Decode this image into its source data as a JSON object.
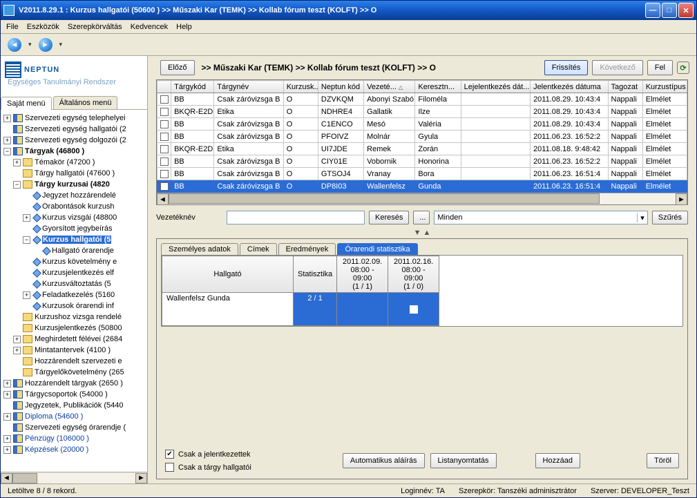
{
  "title": "V2011.8.29.1 : Kurzus hallgatói (50600  )   >> Műszaki Kar (TEMK) >> Kollab fórum teszt (KOLFT) >> O",
  "menus": [
    "File",
    "Eszközök",
    "Szerepkörváltás",
    "Kedvencek",
    "Help"
  ],
  "logo": {
    "name": "NEPTUN",
    "sub": "Egységes Tanulmányi Rendszer"
  },
  "sidebar_tabs": {
    "active": "Saját menü",
    "other": "Általános menü"
  },
  "tree": {
    "n1": "Szervezeti egység telephelyei",
    "n2": "Szervezeti egység hallgatói (2",
    "n3": "Szervezeti egység dolgozói (2",
    "n4": "Tárgyak (46800  )",
    "n5": "Témakör (47200  )",
    "n6": "Tárgy hallgatói (47600  )",
    "n7": "Tárgy kurzusai (4820",
    "n8": "Jegyzet hozzárendelé",
    "n9": "Órabontások kurzush",
    "n10": "Kurzus vizsgái (48800",
    "n11": "Gyorsított jegybeírás",
    "n12": "Kurzus hallgatói (5",
    "n13": "Hallgató órarendje",
    "n14": "Kurzus követelmény e",
    "n15": "Kurzusjelentkezés elf",
    "n16": "Kurzusváltoztatás (5",
    "n17": "Feladatkezelés (5160",
    "n18": "Kurzusok órarendi inf",
    "n19": "Kurzushoz vizsga rendelé",
    "n20": "Kurzusjelentkezés (50800",
    "n21": "Meghirdetett félévei (2684",
    "n22": "Mintatantervek (4100  )",
    "n23": "Hozzárendelt szervezeti e",
    "n24": "Tárgyelőkövetelmény (265",
    "n25": "Hozzárendelt tárgyak (2650  )",
    "n26": "Tárgycsoportok (54000  )",
    "n27": "Jegyzetek, Publikációk (5440",
    "n28": "Diploma (54600  )",
    "n29": "Szervezeti egység órarendje (",
    "n30": "Pénzügy (106000  )",
    "n31": "Képzések (20000  )"
  },
  "crumb": {
    "prev": "Előző",
    "path": ">>  Műszaki Kar (TEMK) >> Kollab fórum teszt (KOLFT) >> O",
    "refresh": "Frissítés",
    "next": "Következő",
    "up": "Fel"
  },
  "grid": {
    "headers": {
      "h0": "",
      "h1": "Tárgykód",
      "h2": "Tárgynév",
      "h3": "Kurzusk...",
      "h4": "Neptun kód",
      "h5": "Vezeté...",
      "h6": "Keresztn...",
      "h7": "Lejelentkezés dát...",
      "h8": "Jelentkezés dátuma",
      "h9": "Tagozat",
      "h10": "Kurzustípus"
    },
    "rows": [
      {
        "c1": "BB",
        "c2": "Csak záróvizsga B",
        "c3": "O",
        "c4": "DZVKQM",
        "c5": "Abonyi Szabó",
        "c6": "Filoméla",
        "c7": "",
        "c8": "2011.08.29. 10:43:4",
        "c9": "Nappali",
        "c10": "Elmélet"
      },
      {
        "c1": "BKQR-E2D",
        "c2": "Etika",
        "c3": "O",
        "c4": "NDHRE4",
        "c5": "Gallatik",
        "c6": "Ilze",
        "c7": "",
        "c8": "2011.08.29. 10:43:4",
        "c9": "Nappali",
        "c10": "Elmélet"
      },
      {
        "c1": "BB",
        "c2": "Csak záróvizsga B",
        "c3": "O",
        "c4": "C1ENCO",
        "c5": "Mesó",
        "c6": "Valéria",
        "c7": "",
        "c8": "2011.08.29. 10:43:4",
        "c9": "Nappali",
        "c10": "Elmélet"
      },
      {
        "c1": "BB",
        "c2": "Csak záróvizsga B",
        "c3": "O",
        "c4": "PFOIVZ",
        "c5": "Molnár",
        "c6": "Gyula",
        "c7": "",
        "c8": "2011.06.23. 16:52:2",
        "c9": "Nappali",
        "c10": "Elmélet"
      },
      {
        "c1": "BKQR-E2D",
        "c2": "Etika",
        "c3": "O",
        "c4": "UI7JDE",
        "c5": "Remek",
        "c6": "Zorán",
        "c7": "",
        "c8": "2011.08.18. 9:48:42",
        "c9": "Nappali",
        "c10": "Elmélet"
      },
      {
        "c1": "BB",
        "c2": "Csak záróvizsga B",
        "c3": "O",
        "c4": "CIY01E",
        "c5": "Vobornik",
        "c6": "Honorina",
        "c7": "",
        "c8": "2011.06.23. 16:52:2",
        "c9": "Nappali",
        "c10": "Elmélet"
      },
      {
        "c1": "BB",
        "c2": "Csak záróvizsga B",
        "c3": "O",
        "c4": "GTSOJ4",
        "c5": "Vranay",
        "c6": "Bora",
        "c7": "",
        "c8": "2011.06.23. 16:51:4",
        "c9": "Nappali",
        "c10": "Elmélet"
      },
      {
        "c1": "BB",
        "c2": "Csak záróvizsga B",
        "c3": "O",
        "c4": "DP8I03",
        "c5": "Wallenfelsz",
        "c6": "Gunda",
        "c7": "",
        "c8": "2011.06.23. 16:51:4",
        "c9": "Nappali",
        "c10": "Elmélet"
      }
    ]
  },
  "filter": {
    "label": "Vezetéknév",
    "search_btn": "Keresés",
    "dots": "...",
    "select_value": "Minden",
    "filter_btn": "Szűrés"
  },
  "detail": {
    "tabs": {
      "t1": "Személyes adatok",
      "t2": "Címek",
      "t3": "Eredmények",
      "t4": "Órarendi statisztika"
    },
    "headers": {
      "student": "Hallgató",
      "stat": "Statisztika",
      "d1a": "2011.02.09.",
      "d1b": "08:00 - 09:00",
      "d1c": "(1 / 1)",
      "d2a": "2011.02.16.",
      "d2b": "08:00 - 09:00",
      "d2c": "(1 / 0)"
    },
    "row": {
      "name": "Wallenfelsz Gunda",
      "stat": "2 / 1"
    }
  },
  "bottom": {
    "chk1": "Csak a jelentkezettek",
    "chk2": "Csak a tárgy hallgatói",
    "b1": "Automatikus aláírás",
    "b2": "Listanyomtatás",
    "b3": "Hozzáad",
    "b4": "Töröl"
  },
  "status": {
    "left": "Letöltve 8 / 8 rekord.",
    "login": "Loginnév: TA",
    "role": "Szerepkör: Tanszéki adminisztrátor",
    "server": "Szerver: DEVELOPER_Teszt"
  }
}
